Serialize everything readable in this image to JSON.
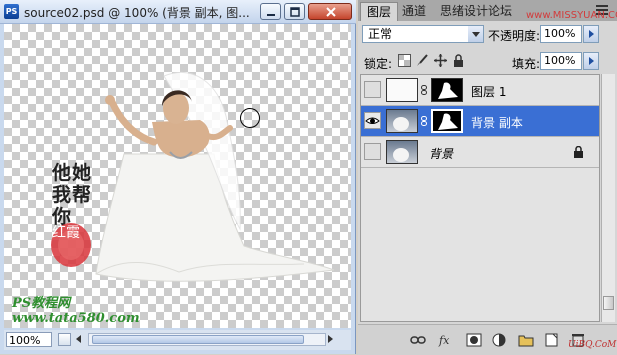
{
  "document": {
    "app_icon": "PS",
    "title": "source02.psd @ 100% (背景 副本, 图...",
    "zoom": "100%",
    "calligraphy": "他她 我帮 你",
    "seal_text": "红霞",
    "watermark_line1": "PS教程网",
    "watermark_line2": "www.tata580.com"
  },
  "panel": {
    "tabs": [
      "图层",
      "通道",
      "思绪设计论坛"
    ],
    "site_stamp": "www.MISSYUAN.COM",
    "blend_mode": "正常",
    "opacity_label": "不透明度:",
    "opacity_value": "100%",
    "lock_label": "锁定:",
    "fill_label": "填充:",
    "fill_value": "100%",
    "layers": [
      {
        "name": "图层 1",
        "visible": false,
        "selected": false
      },
      {
        "name": "背景 副本",
        "visible": true,
        "selected": true
      },
      {
        "name": "背景",
        "visible": false,
        "selected": false,
        "locked": true
      }
    ],
    "footer_stamp": "UiBQ.CoM"
  },
  "colors": {
    "selection": "#3a6fd4",
    "watermark_green": "#2f8f2f",
    "seal_red": "#d8343a"
  }
}
